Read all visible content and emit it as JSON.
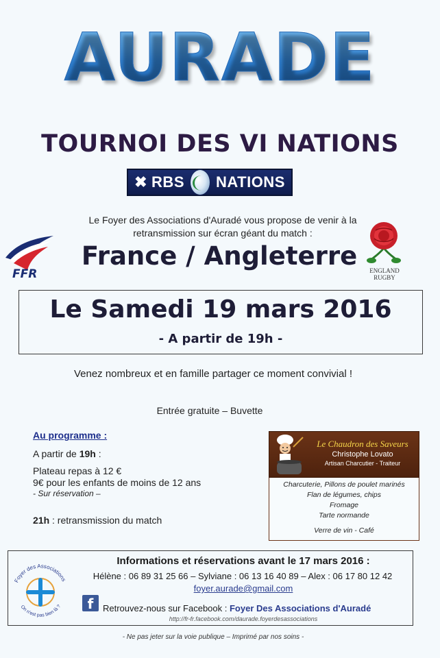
{
  "header": {
    "title": "AURADE",
    "subtitle": "TOURNOI DES VI NATIONS"
  },
  "rbs_banner": {
    "left_text": "RBS",
    "right_text": "NATIONS"
  },
  "intro": {
    "line1": "Le Foyer des Associations d'Auradé vous propose de venir à la",
    "line2": "retransmission sur écran géant du match :"
  },
  "logos": {
    "ffr_text": "FFR",
    "england_line1": "ENGLAND",
    "england_line2": "RUGBY"
  },
  "match": "France / Angleterre",
  "date": {
    "main": "Le Samedi 19 mars 2016",
    "sub": "- A partir de 19h -"
  },
  "convivial": "Venez nombreux et en famille partager ce moment convivial !",
  "entree": "Entrée gratuite – Buvette",
  "program": {
    "title": "Au programme :",
    "start_prefix": "A partir de ",
    "start_time": "19h",
    "start_suffix": " :",
    "plateau": "Plateau repas à 12 €",
    "enfants": "9€ pour les enfants de moins de 12 ans",
    "reservation": "- Sur réservation –",
    "match_time": "21h",
    "match_text": " : retransmission du match"
  },
  "chaudron": {
    "title": "Le Chaudron des Saveurs",
    "name": "Christophe Lovato",
    "role": "Artisan Charcutier - Traiteur",
    "items": [
      "Charcuterie, Pillons de poulet marinés",
      "Flan de légumes, chips",
      "Fromage",
      "Tarte normande",
      "Verre de vin - Café"
    ]
  },
  "info": {
    "title": "Informations et réservations avant le 17 mars 2016 :",
    "phones": "Hélène : 06 89 31 25 66 – Sylviane : 06 13 16 40 89 – Alex : 06 17 80 12 42",
    "email": "foyer.aurade@gmail.com",
    "facebook_prefix": "Retrouvez-nous sur Facebook : ",
    "facebook_name": "Foyer Des Associations d'Auradé",
    "facebook_url": "http://fr-fr.facebook.com/daurade.foyerdesassociations",
    "logo_top": "Foyer des Associations",
    "logo_bottom": "On n'est pas bien là ?"
  },
  "footer": "- Ne pas jeter sur la voie publique – Imprimé par nos soins -",
  "colors": {
    "title_blue": "#2f7fcf",
    "navy": "#1e1d37",
    "rbs_bg": "#1b2d6e",
    "chaudron_brown": "#6b3317",
    "facebook_blue": "#3b5998"
  }
}
